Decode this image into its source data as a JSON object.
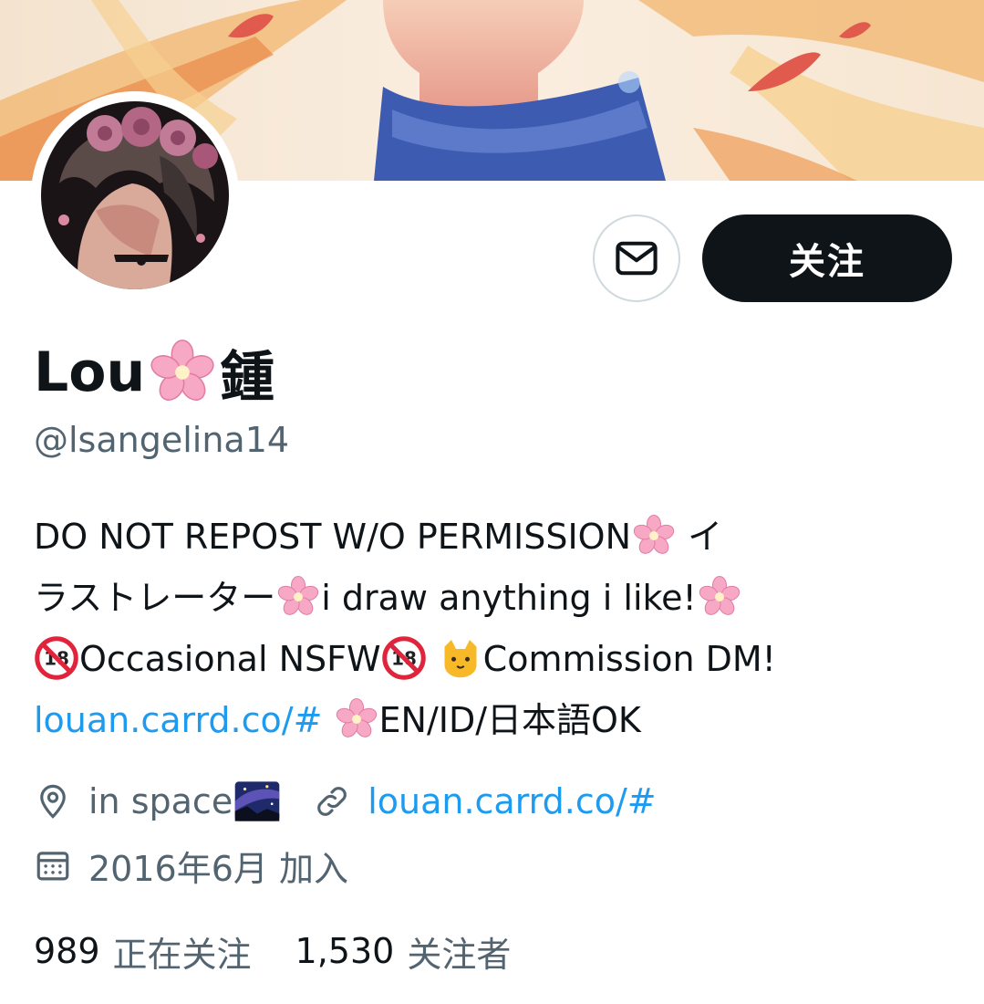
{
  "profile": {
    "name_part1": "Lou",
    "name_emoji": "cherry-blossom",
    "name_part2": "鍾",
    "handle": "@lsangelina14"
  },
  "actions": {
    "follow_label": "关注",
    "message_icon": "envelope-icon"
  },
  "bio": {
    "line1_text": "DO NOT REPOST W/O PERMISSION",
    "line1_tail": " イ",
    "line2_a": "ラストレーター",
    "line2_b": "i draw anything i like!",
    "line3_a": "Occasional NSFW",
    "line3_b": "Commission DM!",
    "line4_link": "louan.carrd.co/#",
    "line4_text": "EN/ID/日本語OK"
  },
  "meta": {
    "location": "in space",
    "website": "louan.carrd.co/#",
    "joined": "2016年6月 加入"
  },
  "stats": {
    "following_count": "989",
    "following_label": "正在关注",
    "followers_count": "1,530",
    "followers_label": "关注者"
  },
  "colors": {
    "text": "#0f1419",
    "secondary": "#536471",
    "link": "#1d9bf0",
    "button_dark": "#0f1419"
  }
}
